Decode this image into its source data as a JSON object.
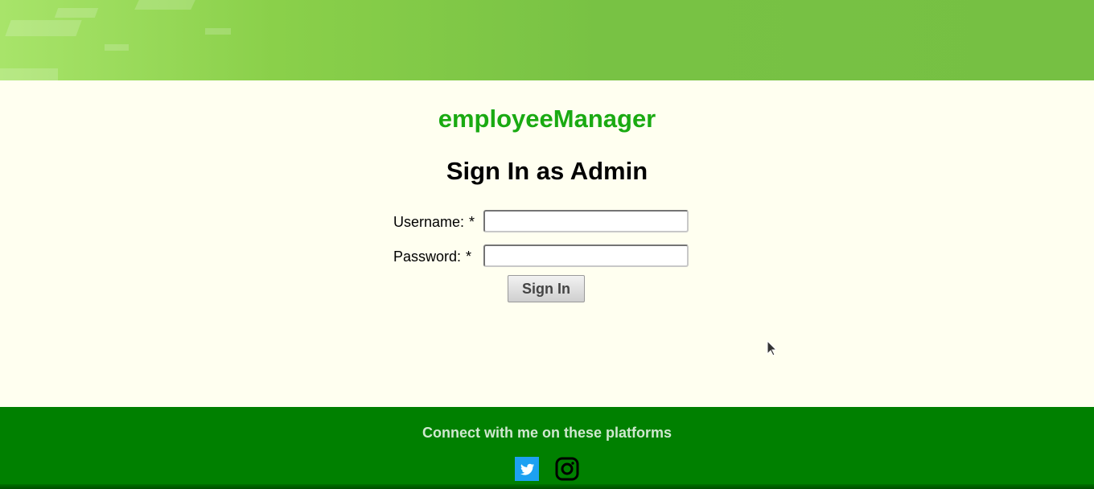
{
  "header": {
    "banner_color": "#7bc244"
  },
  "app": {
    "title": "employeeManager",
    "title_color": "#1aaa12"
  },
  "form": {
    "heading": "Sign In as Admin",
    "username": {
      "label": "Username:",
      "required_mark": "*",
      "value": "",
      "placeholder": ""
    },
    "password": {
      "label": "Password:",
      "required_mark": "*",
      "value": "",
      "placeholder": ""
    },
    "submit_label": "Sign In"
  },
  "footer": {
    "text": "Connect with me on these platforms",
    "background_color": "#008000",
    "links": [
      {
        "icon": "twitter-icon",
        "color": "#1da1f2"
      },
      {
        "icon": "instagram-icon",
        "color": "#000000"
      }
    ]
  }
}
